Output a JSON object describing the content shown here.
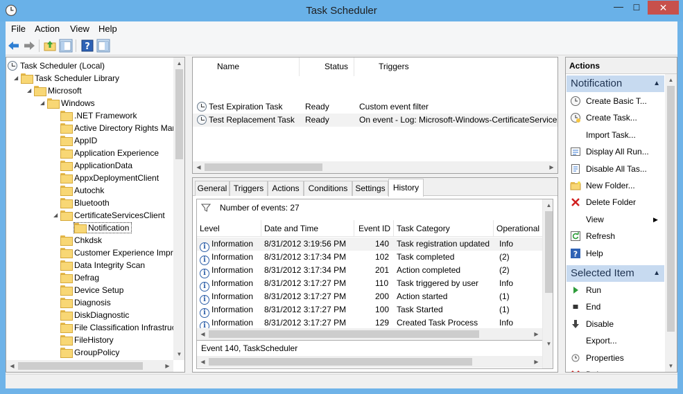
{
  "window": {
    "title": "Task Scheduler"
  },
  "menu": [
    "File",
    "Action",
    "View",
    "Help"
  ],
  "tree": [
    {
      "label": "Task Scheduler (Local)",
      "level": 0,
      "icon": "clock-icon",
      "expander": ""
    },
    {
      "label": "Task Scheduler Library",
      "level": 1,
      "icon": "folder-icon",
      "expander": "◢"
    },
    {
      "label": "Microsoft",
      "level": 2,
      "icon": "folder-icon",
      "expander": "◢"
    },
    {
      "label": "Windows",
      "level": 3,
      "icon": "folder-icon",
      "expander": "◢"
    },
    {
      "label": ".NET Framework",
      "level": 4,
      "icon": "folder-icon",
      "expander": ""
    },
    {
      "label": "Active Directory Rights Mar",
      "level": 4,
      "icon": "folder-icon",
      "expander": ""
    },
    {
      "label": "AppID",
      "level": 4,
      "icon": "folder-icon",
      "expander": ""
    },
    {
      "label": "Application Experience",
      "level": 4,
      "icon": "folder-icon",
      "expander": ""
    },
    {
      "label": "ApplicationData",
      "level": 4,
      "icon": "folder-icon",
      "expander": ""
    },
    {
      "label": "AppxDeploymentClient",
      "level": 4,
      "icon": "folder-icon",
      "expander": ""
    },
    {
      "label": "Autochk",
      "level": 4,
      "icon": "folder-icon",
      "expander": ""
    },
    {
      "label": "Bluetooth",
      "level": 4,
      "icon": "folder-icon",
      "expander": ""
    },
    {
      "label": "CertificateServicesClient",
      "level": 4,
      "icon": "folder-icon",
      "expander": "◢"
    },
    {
      "label": "Notification",
      "level": 5,
      "icon": "folder-icon",
      "expander": "",
      "selected": true
    },
    {
      "label": "Chkdsk",
      "level": 4,
      "icon": "folder-icon",
      "expander": ""
    },
    {
      "label": "Customer Experience Impro",
      "level": 4,
      "icon": "folder-icon",
      "expander": ""
    },
    {
      "label": "Data Integrity Scan",
      "level": 4,
      "icon": "folder-icon",
      "expander": ""
    },
    {
      "label": "Defrag",
      "level": 4,
      "icon": "folder-icon",
      "expander": ""
    },
    {
      "label": "Device Setup",
      "level": 4,
      "icon": "folder-icon",
      "expander": ""
    },
    {
      "label": "Diagnosis",
      "level": 4,
      "icon": "folder-icon",
      "expander": ""
    },
    {
      "label": "DiskDiagnostic",
      "level": 4,
      "icon": "folder-icon",
      "expander": ""
    },
    {
      "label": "File Classification Infrastruc",
      "level": 4,
      "icon": "folder-icon",
      "expander": ""
    },
    {
      "label": "FileHistory",
      "level": 4,
      "icon": "folder-icon",
      "expander": ""
    },
    {
      "label": "GroupPolicy",
      "level": 4,
      "icon": "folder-icon",
      "expander": ""
    }
  ],
  "tasks": {
    "columns": [
      "Name",
      "Status",
      "Triggers"
    ],
    "rows": [
      {
        "name": "Test Expiration Task",
        "status": "Ready",
        "triggers": "Custom event filter"
      },
      {
        "name": "Test Replacement Task",
        "status": "Ready",
        "triggers": "On event - Log: Microsoft-Windows-CertificateService"
      }
    ]
  },
  "tabs": [
    "General",
    "Triggers",
    "Actions",
    "Conditions",
    "Settings",
    "History"
  ],
  "active_tab": "History",
  "history": {
    "event_count_label": "Number of events: 27",
    "columns": [
      "Level",
      "Date and Time",
      "Event ID",
      "Task Category",
      "Operational"
    ],
    "rows": [
      {
        "level": "Information",
        "datetime": "8/31/2012 3:19:56 PM",
        "event_id": "140",
        "category": "Task registration updated",
        "op": "Info"
      },
      {
        "level": "Information",
        "datetime": "8/31/2012 3:17:34 PM",
        "event_id": "102",
        "category": "Task completed",
        "op": "(2)"
      },
      {
        "level": "Information",
        "datetime": "8/31/2012 3:17:34 PM",
        "event_id": "201",
        "category": "Action completed",
        "op": "(2)"
      },
      {
        "level": "Information",
        "datetime": "8/31/2012 3:17:27 PM",
        "event_id": "110",
        "category": "Task triggered by user",
        "op": "Info"
      },
      {
        "level": "Information",
        "datetime": "8/31/2012 3:17:27 PM",
        "event_id": "200",
        "category": "Action started",
        "op": "(1)"
      },
      {
        "level": "Information",
        "datetime": "8/31/2012 3:17:27 PM",
        "event_id": "100",
        "category": "Task Started",
        "op": "(1)"
      },
      {
        "level": "Information",
        "datetime": "8/31/2012 3:17:27 PM",
        "event_id": "129",
        "category": "Created Task Process",
        "op": "Info"
      }
    ],
    "footer": "Event 140, TaskScheduler"
  },
  "actions": {
    "title": "Actions",
    "section1": "Notification",
    "items1": [
      {
        "label": "Create Basic T...",
        "icon": "create-basic-task-icon"
      },
      {
        "label": "Create Task...",
        "icon": "create-task-icon"
      },
      {
        "label": "Import Task...",
        "icon": ""
      },
      {
        "label": "Display All Run...",
        "icon": "display-running-icon"
      },
      {
        "label": "Disable All Tas...",
        "icon": "disable-history-icon"
      },
      {
        "label": "New Folder...",
        "icon": "new-folder-icon"
      },
      {
        "label": "Delete Folder",
        "icon": "delete-icon"
      },
      {
        "label": "View",
        "icon": ""
      },
      {
        "label": "Refresh",
        "icon": "refresh-icon"
      },
      {
        "label": "Help",
        "icon": "help-icon"
      }
    ],
    "section2": "Selected Item",
    "items2": [
      {
        "label": "Run",
        "icon": "run-icon"
      },
      {
        "label": "End",
        "icon": "end-icon"
      },
      {
        "label": "Disable",
        "icon": "disable-icon"
      },
      {
        "label": "Export...",
        "icon": ""
      },
      {
        "label": "Properties",
        "icon": "properties-icon"
      },
      {
        "label": "Delete",
        "icon": "delete-icon"
      }
    ]
  },
  "colors": {
    "title_bar": "#69b1e8",
    "section_header": "#c7daf0",
    "close_button": "#c7504b"
  }
}
